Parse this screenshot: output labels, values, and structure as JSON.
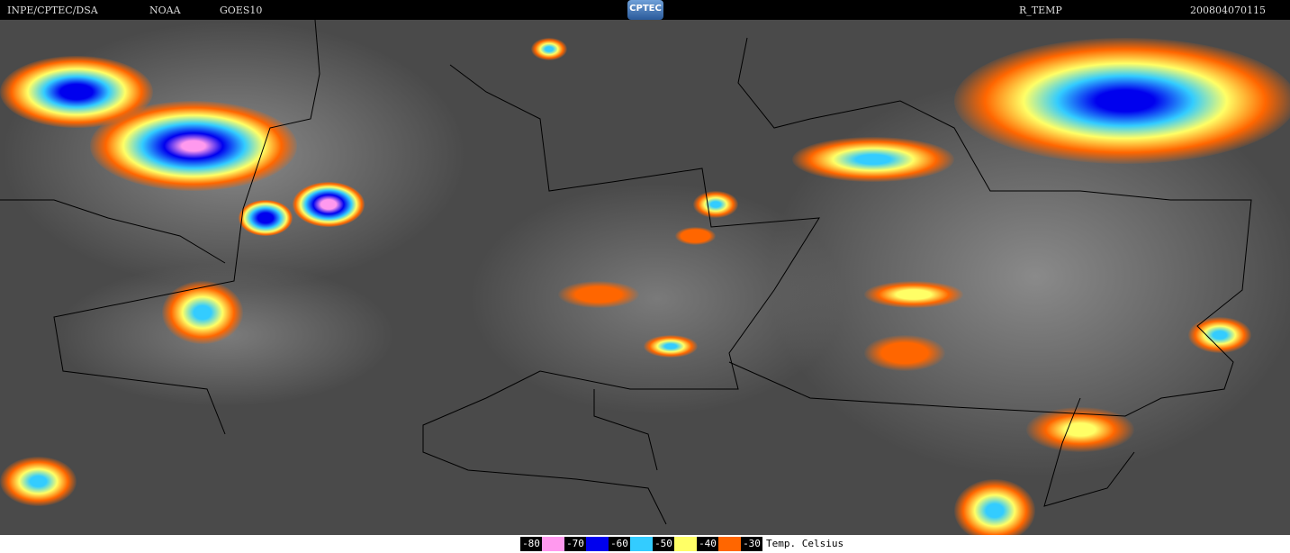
{
  "header": {
    "source": "INPE/CPTEC/DSA",
    "agency": "NOAA",
    "satellite": "GOES10",
    "logo": "CPTEC",
    "product": "R_TEMP",
    "timestamp": "200804070115"
  },
  "legend": {
    "title": "Temp. Celsius",
    "items": [
      {
        "label": "-80",
        "color": "#ff99ee"
      },
      {
        "label": "-70",
        "color": "#0000ee"
      },
      {
        "label": "-60",
        "color": "#33ccff"
      },
      {
        "label": "-50",
        "color": "#ffff66"
      },
      {
        "label": "-40",
        "color": "#ff6600"
      },
      {
        "label": "-30",
        "color": ""
      }
    ]
  }
}
